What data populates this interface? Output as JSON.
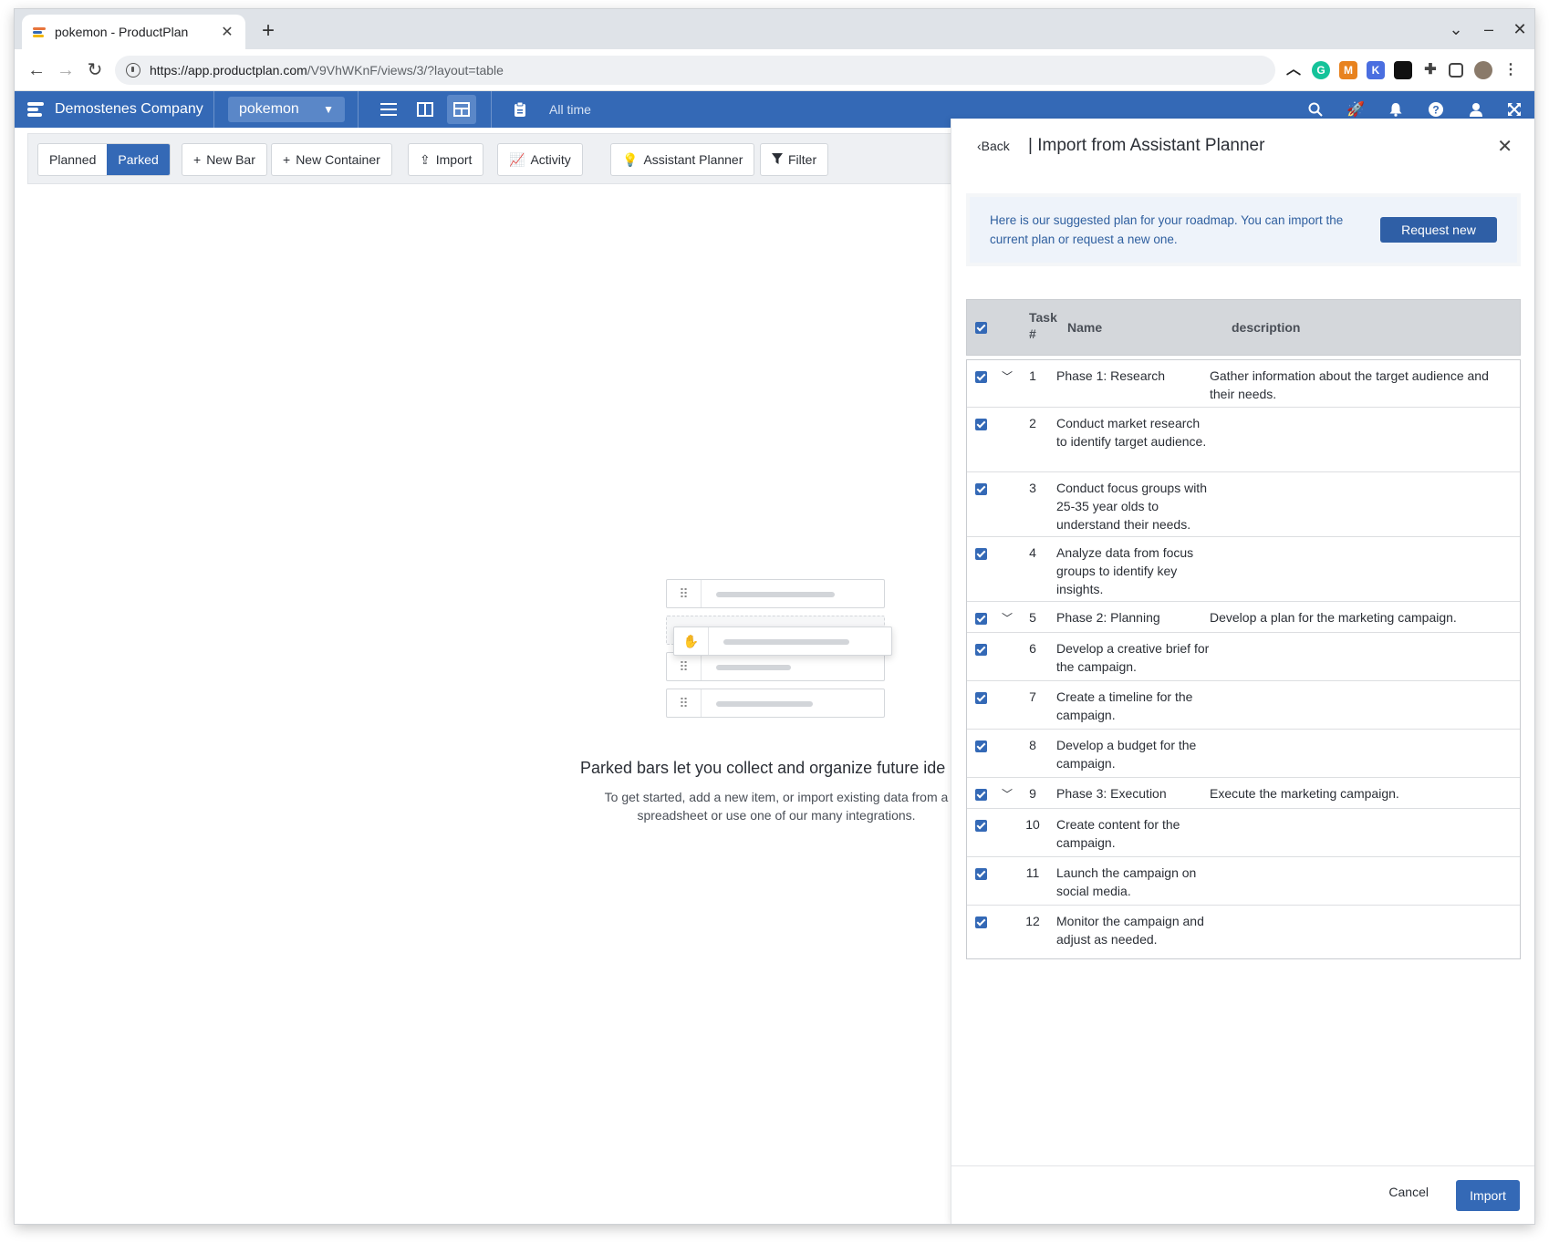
{
  "browser": {
    "tab_title": "pokemon - ProductPlan",
    "url_host": "https://app.productplan.com",
    "url_path": "/V9VhWKnF/views/3/?layout=table"
  },
  "app": {
    "company": "Demostenes Company",
    "roadmap": "pokemon",
    "time_filter": "All time"
  },
  "toolbar": {
    "planned": "Planned",
    "parked": "Parked",
    "new_bar": "New Bar",
    "new_container": "New Container",
    "import": "Import",
    "activity": "Activity",
    "assistant_planner": "Assistant Planner",
    "filter": "Filter"
  },
  "empty_state": {
    "title": "Parked bars let you collect and organize future ide",
    "subtitle": "To get started, add a new item, or import existing data from a spreadsheet or use one of our many integrations."
  },
  "drawer": {
    "back": "Back",
    "title": "| Import from Assistant Planner",
    "notice": "Here is our suggested plan for your roadmap. You can import the current plan or request a new one.",
    "request_new": "Request new",
    "columns": {
      "task": "Task #",
      "name": "Name",
      "description": "description"
    },
    "rows": [
      {
        "num": "1",
        "name": "Phase 1: Research",
        "description": "Gather information about the target audience and their needs.",
        "phase": true,
        "h": 52
      },
      {
        "num": "2",
        "name": "Conduct market research to identify target audience.",
        "description": "",
        "phase": false,
        "h": 71
      },
      {
        "num": "3",
        "name": "Conduct focus groups with 25-35 year olds to understand their needs.",
        "description": "",
        "phase": false,
        "h": 71
      },
      {
        "num": "4",
        "name": "Analyze data from focus groups to identify key insights.",
        "description": "",
        "phase": false,
        "h": 71
      },
      {
        "num": "5",
        "name": "Phase 2: Planning",
        "description": "Develop a plan for the marketing campaign.",
        "phase": true,
        "h": 34
      },
      {
        "num": "6",
        "name": "Develop a creative brief for the campaign.",
        "description": "",
        "phase": false,
        "h": 53
      },
      {
        "num": "7",
        "name": "Create a timeline for the campaign.",
        "description": "",
        "phase": false,
        "h": 53
      },
      {
        "num": "8",
        "name": "Develop a budget for the campaign.",
        "description": "",
        "phase": false,
        "h": 53
      },
      {
        "num": "9",
        "name": "Phase 3: Execution",
        "description": "Execute the marketing campaign.",
        "phase": true,
        "h": 34
      },
      {
        "num": "10",
        "name": "Create content for the campaign.",
        "description": "",
        "phase": false,
        "h": 53
      },
      {
        "num": "11",
        "name": "Launch the campaign on social media.",
        "description": "",
        "phase": false,
        "h": 53
      },
      {
        "num": "12",
        "name": "Monitor the campaign and adjust as needed.",
        "description": "",
        "phase": false,
        "h": 58
      }
    ],
    "cancel": "Cancel",
    "import": "Import"
  }
}
